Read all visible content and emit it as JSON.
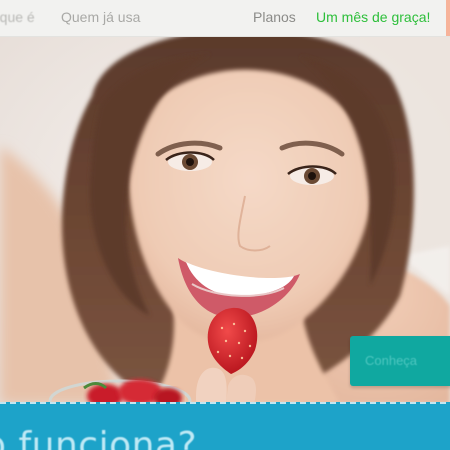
{
  "nav": {
    "partial_left": "o que é",
    "who_uses": "Quem já usa",
    "plans": "Planos",
    "free_month": "Um mês de graça!"
  },
  "hero": {
    "cta_label": "Conheça"
  },
  "section": {
    "title_partial": "o funciona?"
  },
  "colors": {
    "nav_background": "#f2f2f0",
    "nav_cta": "#2dbf3a",
    "cta_button": "#10a8a0",
    "section_blue": "#1da3c9"
  }
}
